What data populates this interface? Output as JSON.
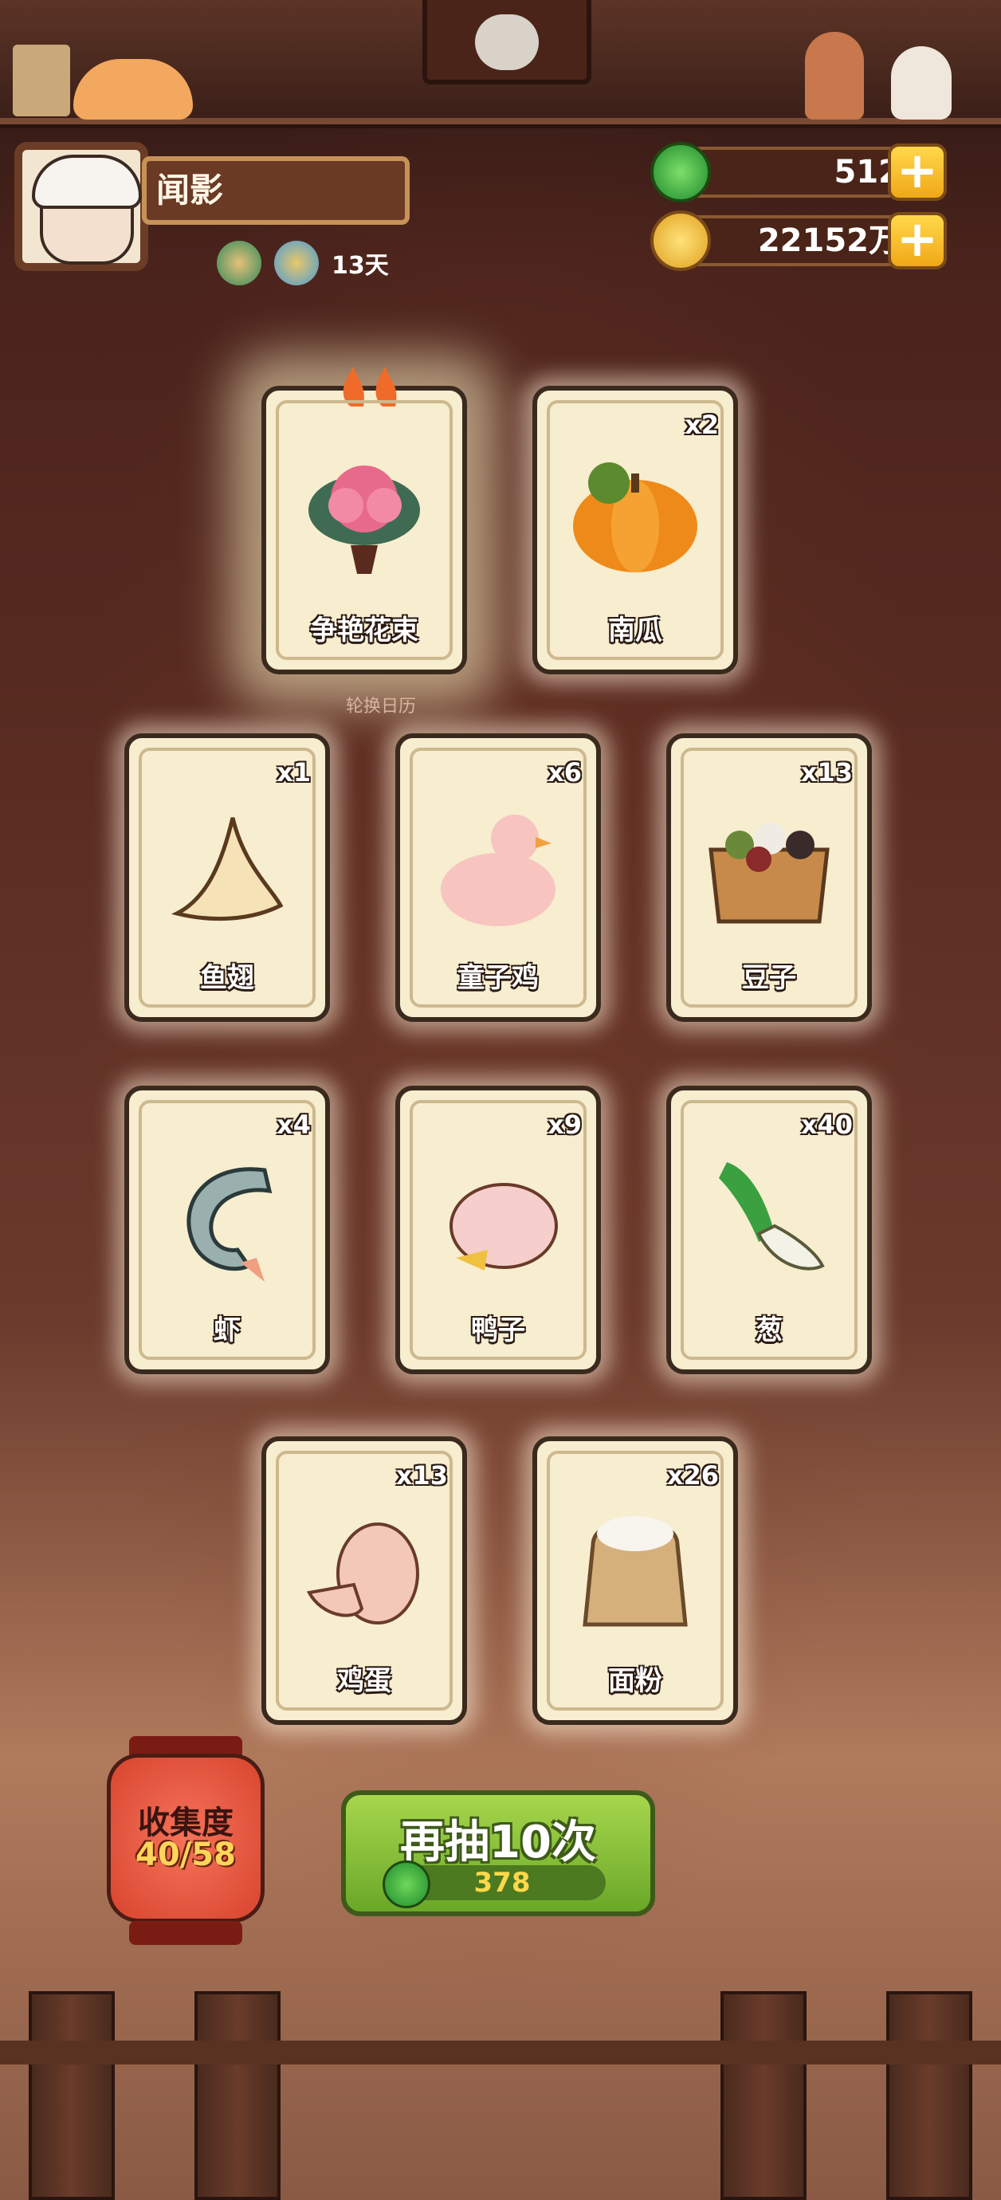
{
  "player": {
    "name": "闻影",
    "days": "13天"
  },
  "currency": {
    "jade": "512",
    "coins": "22152万"
  },
  "featured_section_label": "轮换日历",
  "cards": [
    {
      "label": "争艳花束",
      "count": "",
      "icon": "flower-bouquet-icon"
    },
    {
      "label": "南瓜",
      "count": "x2",
      "icon": "pumpkin-icon"
    },
    {
      "label": "鱼翅",
      "count": "x1",
      "icon": "shark-fin-icon"
    },
    {
      "label": "童子鸡",
      "count": "x6",
      "icon": "chick-icon"
    },
    {
      "label": "豆子",
      "count": "x13",
      "icon": "beans-box-icon"
    },
    {
      "label": "虾",
      "count": "x4",
      "icon": "shrimp-icon"
    },
    {
      "label": "鸭子",
      "count": "x9",
      "icon": "duck-icon"
    },
    {
      "label": "葱",
      "count": "x40",
      "icon": "scallion-icon"
    },
    {
      "label": "鸡蛋",
      "count": "x13",
      "icon": "egg-icon"
    },
    {
      "label": "面粉",
      "count": "x26",
      "icon": "flour-sack-icon"
    }
  ],
  "collection": {
    "title": "收集度",
    "progress": "40/58"
  },
  "draw_button": {
    "label": "再抽10次",
    "cost": "378"
  }
}
